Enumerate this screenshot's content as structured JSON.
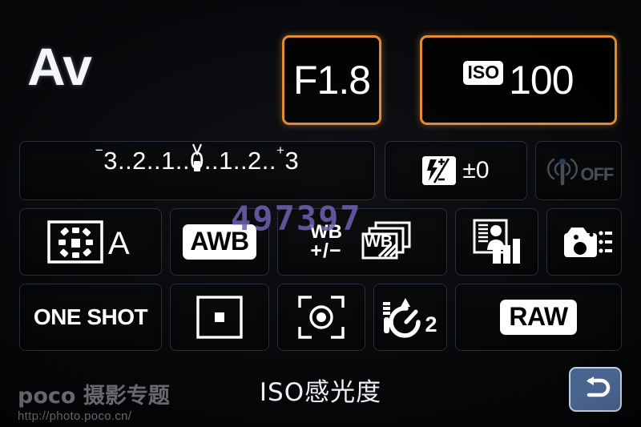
{
  "screen": {
    "device": "camera-quick-control-screen",
    "background_color": "#000000",
    "highlight_color": "#e08a33",
    "return_button_color": "#4a6490"
  },
  "top": {
    "shooting_mode": "Av",
    "aperture": {
      "label": "F1.8",
      "selected": true
    },
    "iso": {
      "badge": "ISO",
      "value": "100",
      "selected": true
    }
  },
  "exposure": {
    "scale_minus": "−",
    "scale_text": "3..2..1..0..1..2..",
    "scale_plus": "+",
    "scale_end": "3",
    "indicator_position": "0",
    "full_text": "-3..2..1..0..1..2..+3"
  },
  "flash_compensation": {
    "icon": "flash-exposure-compensation-icon",
    "value": "±0"
  },
  "wireless": {
    "icon": "wifi-icon",
    "status": "OFF",
    "enabled": false
  },
  "settings": {
    "picture_style": {
      "icon": "picture-style-icon",
      "value": "A"
    },
    "white_balance": {
      "label": "AWB"
    },
    "wb_shift": {
      "line1": "WB",
      "line2": "+/−"
    },
    "wb_bracket": {
      "icon": "wb-bracketing-icon",
      "label": "WB"
    },
    "auto_lighting_optimizer": {
      "icon": "auto-lighting-optimizer-icon"
    },
    "custom_functions": {
      "icon": "custom-controls-icon"
    },
    "af_mode": {
      "label": "ONE SHOT"
    },
    "af_point": {
      "icon": "af-point-single-icon"
    },
    "metering": {
      "icon": "evaluative-metering-icon"
    },
    "drive_mode": {
      "icon": "self-timer-icon",
      "value": "2"
    },
    "image_quality": {
      "label": "RAW"
    }
  },
  "bottom": {
    "title": "ISO感光度",
    "return_icon": "return-arrow-icon"
  },
  "watermark": {
    "brand": "poco 摄影专题",
    "url": "http://photo.poco.cn/",
    "number": "497397"
  }
}
